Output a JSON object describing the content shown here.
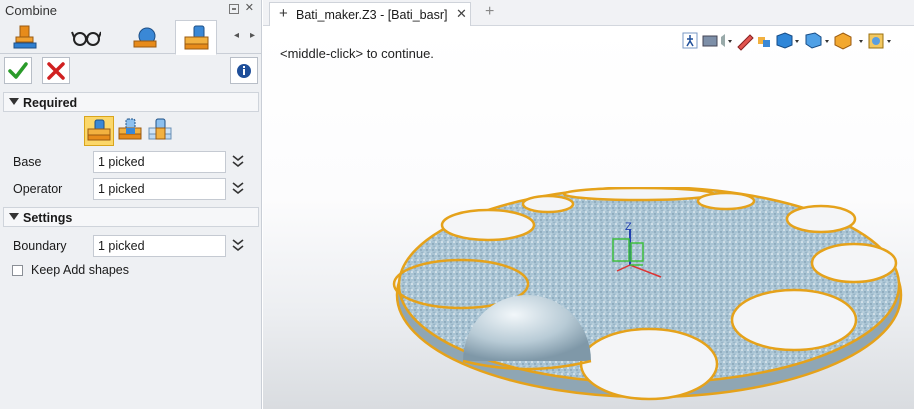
{
  "panel": {
    "title": "Combine",
    "tabs": [
      "stamp-icon",
      "glasses-icon",
      "shapes-icon",
      "combine-icon"
    ],
    "required_label": "Required",
    "settings_label": "Settings",
    "modes": [
      "add-mode-icon",
      "remove-mode-icon",
      "intersect-mode-icon"
    ],
    "fields": {
      "base": {
        "label": "Base",
        "value": "1 picked"
      },
      "operator": {
        "label": "Operator",
        "value": "1 picked"
      },
      "boundary": {
        "label": "Boundary",
        "value": "1 picked"
      }
    },
    "keep_add_shapes": {
      "label": "Keep Add shapes",
      "checked": false
    }
  },
  "document": {
    "tab_title": "Bati_maker.Z3 - [Bati_basr]",
    "hint": "<middle-click> to continue."
  },
  "colors": {
    "accent": "#fbd76a",
    "ok": "#2a9b2a",
    "cancel": "#d02020",
    "edge": "#e5a21b"
  }
}
